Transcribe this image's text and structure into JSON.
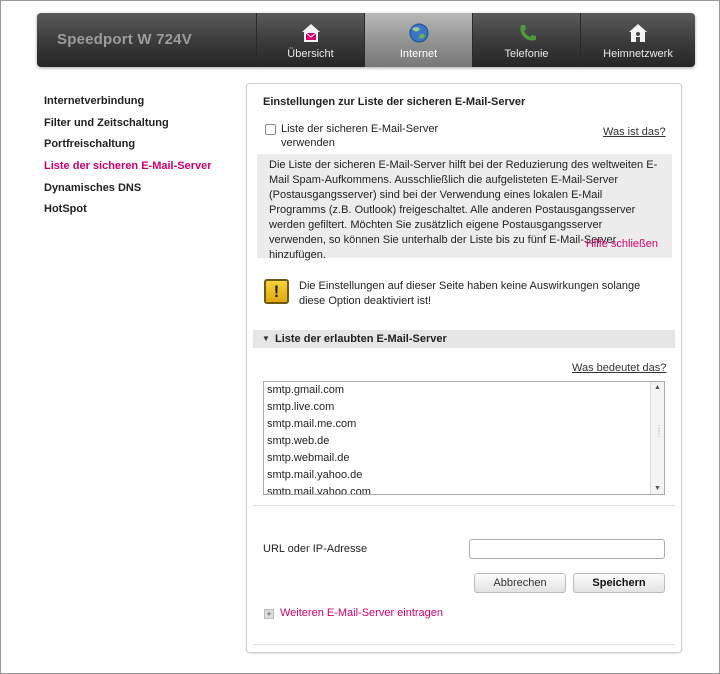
{
  "header": {
    "brand": "Speedport W 724V",
    "tabs": [
      {
        "label": "Übersicht",
        "icon": "home-mail-icon",
        "active": false
      },
      {
        "label": "Internet",
        "icon": "globe-icon",
        "active": true
      },
      {
        "label": "Telefonie",
        "icon": "phone-icon",
        "active": false
      },
      {
        "label": "Heimnetzwerk",
        "icon": "home-network-icon",
        "active": false
      }
    ]
  },
  "sidebar": {
    "items": [
      {
        "label": "Internetverbindung"
      },
      {
        "label": "Filter und Zeitschaltung"
      },
      {
        "label": "Portfreischaltung"
      },
      {
        "label": "Liste der sicheren E-Mail-Server"
      },
      {
        "label": "Dynamisches DNS"
      },
      {
        "label": "HotSpot"
      }
    ]
  },
  "panel": {
    "title": "Einstellungen zur Liste der sicheren E-Mail-Server",
    "checkbox_label": "Liste der sicheren E-Mail-Server verwenden",
    "whats_this": "Was ist das?",
    "help_text": "Die Liste der sicheren E-Mail-Server hilft bei der Reduzierung des weltweiten E-Mail Spam-Aufkommens. Ausschließlich die aufgelisteten E-Mail-Server (Postausgangsserver) sind bei der Verwendung eines lokalen E-Mail Programms (z.B. Outlook) freigeschaltet. Alle anderen Postausgangsserver werden gefiltert. Möchten Sie zusätzlich eigene Postausgangsserver verwenden, so können Sie unterhalb der Liste bis zu fünf E-Mail-Server hinzufügen.",
    "help_close": "Hilfe schließen",
    "warning_text": "Die Einstellungen auf dieser Seite haben keine Auswirkungen solange diese Option deaktiviert ist!",
    "section_title": "Liste der erlaubten E-Mail-Server",
    "what_means": "Was bedeutet das?",
    "servers": [
      "smtp.gmail.com",
      "smtp.live.com",
      "smtp.mail.me.com",
      "smtp.web.de",
      "smtp.webmail.de",
      "smtp.mail.yahoo.de",
      "smtp.mail.yahoo.com"
    ],
    "url_label": "URL oder IP-Adresse",
    "url_value": "",
    "cancel_label": "Abbrechen",
    "save_label": "Speichern",
    "add_server_label": "Weiteren E-Mail-Server eintragen"
  },
  "colors": {
    "accent": "#d1006e",
    "header_bg": "#3a3a3a",
    "help_bg": "#ececec"
  }
}
